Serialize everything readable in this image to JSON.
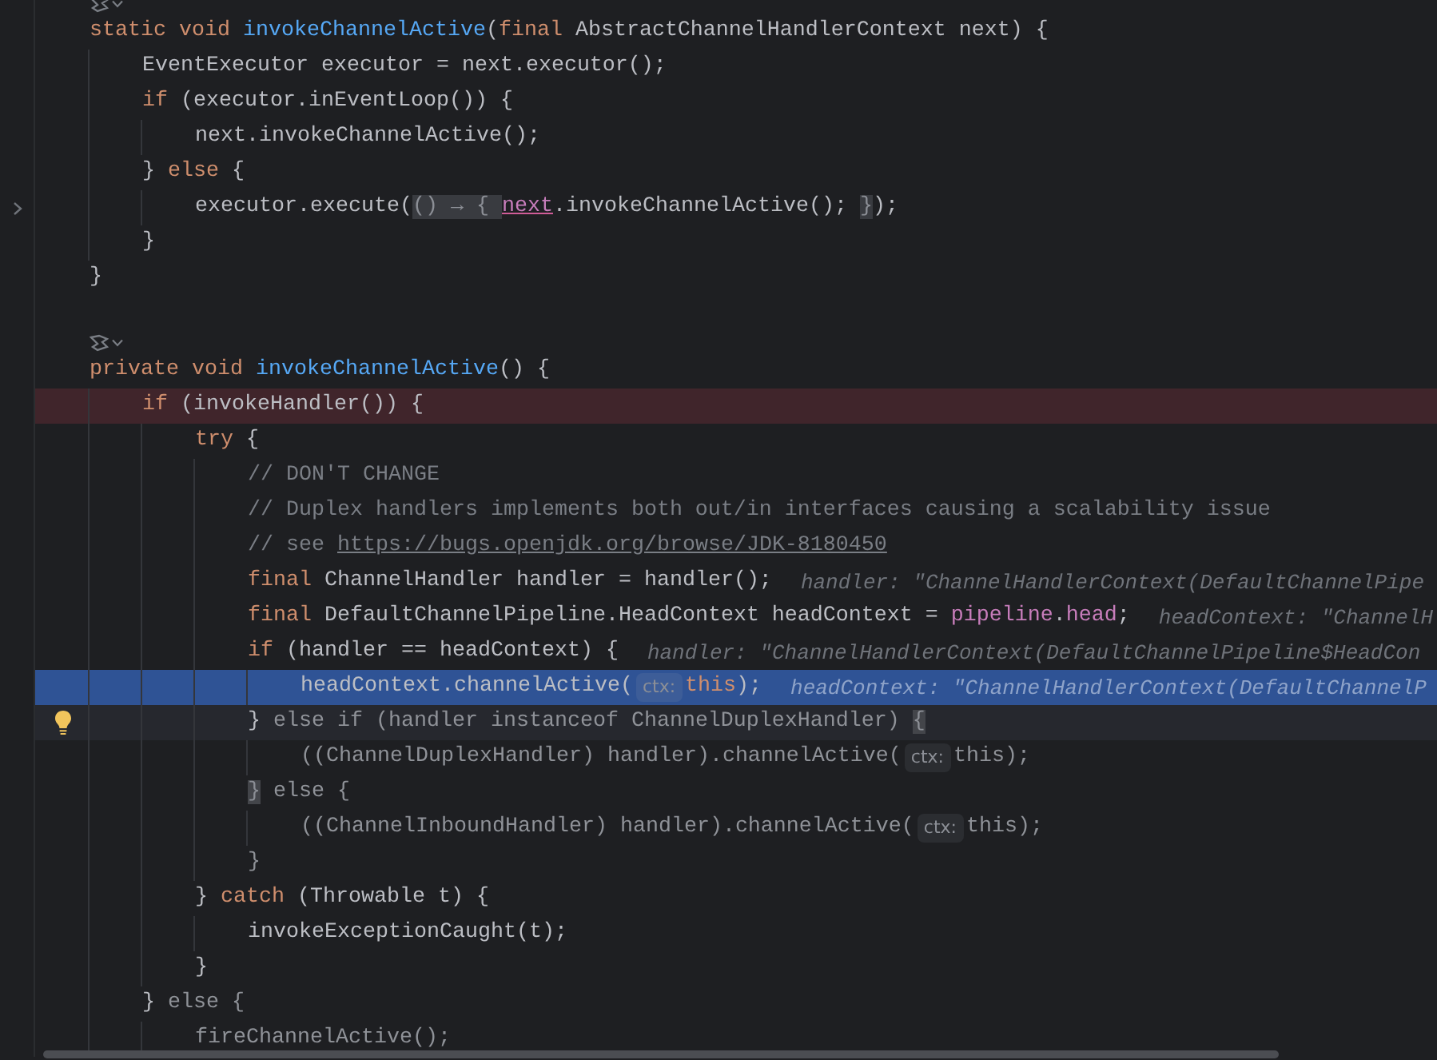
{
  "editor": {
    "lines": [
      {
        "kind": "lens"
      },
      {
        "kind": "code",
        "segments": [
          {
            "kind": "code",
            "tokens": [
              {
                "kind": "keyword",
                "text": "static void "
              },
              {
                "kind": "method",
                "text": "invokeChannelActive"
              },
              {
                "kind": "plain",
                "text": "("
              },
              {
                "kind": "keyword",
                "text": "final"
              },
              {
                "kind": "plain",
                "text": " AbstractChannelHandlerContext next) {"
              }
            ]
          }
        ]
      },
      {
        "kind": "code",
        "segments": [
          {
            "kind": "code",
            "tokens": [
              {
                "kind": "plain",
                "text": "    EventExecutor executor = next.executor();"
              }
            ]
          }
        ]
      },
      {
        "kind": "code",
        "segments": [
          {
            "kind": "code",
            "tokens": [
              {
                "kind": "keyword",
                "text": "    if"
              },
              {
                "kind": "plain",
                "text": " (executor.inEventLoop()) {"
              }
            ]
          }
        ]
      },
      {
        "kind": "code",
        "segments": [
          {
            "kind": "code",
            "tokens": [
              {
                "kind": "plain",
                "text": "        next.invokeChannelActive();"
              }
            ]
          }
        ]
      },
      {
        "kind": "code",
        "segments": [
          {
            "kind": "code",
            "tokens": [
              {
                "kind": "plain",
                "text": "    } "
              },
              {
                "kind": "keyword",
                "text": "else"
              },
              {
                "kind": "plain",
                "text": " {"
              }
            ]
          }
        ]
      },
      {
        "kind": "code",
        "fold_marker": true,
        "segments": [
          {
            "kind": "code",
            "tokens": [
              {
                "kind": "plain",
                "text": "        executor.execute("
              },
              {
                "kind": "folded",
                "text": "() → { "
              },
              {
                "kind": "captured",
                "text": "next"
              },
              {
                "kind": "plain",
                "text": ".invokeChannelActive(); "
              },
              {
                "kind": "folded",
                "text": "}"
              },
              {
                "kind": "plain",
                "text": ");"
              }
            ]
          }
        ]
      },
      {
        "kind": "code",
        "segments": [
          {
            "kind": "code",
            "tokens": [
              {
                "kind": "plain",
                "text": "    }"
              }
            ]
          }
        ]
      },
      {
        "kind": "code",
        "segments": [
          {
            "kind": "code",
            "tokens": [
              {
                "kind": "plain",
                "text": "}"
              }
            ]
          }
        ]
      },
      {
        "kind": "blank"
      },
      {
        "kind": "lens"
      },
      {
        "kind": "code",
        "segments": [
          {
            "kind": "code",
            "tokens": [
              {
                "kind": "keyword",
                "text": "private void "
              },
              {
                "kind": "method",
                "text": "invokeChannelActive"
              },
              {
                "kind": "plain",
                "text": "() {"
              }
            ]
          }
        ]
      },
      {
        "kind": "code",
        "breakpoint": true,
        "segments": [
          {
            "kind": "code",
            "tokens": [
              {
                "kind": "keyword",
                "text": "    if"
              },
              {
                "kind": "plain",
                "text": " (invokeHandler()) {"
              }
            ]
          }
        ]
      },
      {
        "kind": "code",
        "segments": [
          {
            "kind": "code",
            "tokens": [
              {
                "kind": "keyword",
                "text": "        try"
              },
              {
                "kind": "plain",
                "text": " {"
              }
            ]
          }
        ]
      },
      {
        "kind": "code",
        "segments": [
          {
            "kind": "code",
            "tokens": [
              {
                "kind": "comment",
                "text": "            // DON'T CHANGE"
              }
            ]
          }
        ]
      },
      {
        "kind": "code",
        "segments": [
          {
            "kind": "code",
            "tokens": [
              {
                "kind": "comment",
                "text": "            // Duplex handlers implements both out/in interfaces causing a scalability issue"
              }
            ]
          }
        ]
      },
      {
        "kind": "code",
        "segments": [
          {
            "kind": "code",
            "tokens": [
              {
                "kind": "comment",
                "text": "            // see "
              },
              {
                "kind": "link",
                "text": "https://bugs.openjdk.org/browse/JDK-8180450"
              }
            ]
          }
        ]
      },
      {
        "kind": "code",
        "segments": [
          {
            "kind": "code",
            "tokens": [
              {
                "kind": "keyword",
                "text": "            final"
              },
              {
                "kind": "plain",
                "text": " ChannelHandler handler = handler();"
              }
            ]
          },
          {
            "kind": "value",
            "text": "handler: \"ChannelHandlerContext(DefaultChannelPipe"
          }
        ]
      },
      {
        "kind": "code",
        "segments": [
          {
            "kind": "code",
            "tokens": [
              {
                "kind": "keyword",
                "text": "            final"
              },
              {
                "kind": "plain",
                "text": " DefaultChannelPipeline.HeadContext headContext = "
              },
              {
                "kind": "field",
                "text": "pipeline"
              },
              {
                "kind": "plain",
                "text": "."
              },
              {
                "kind": "field",
                "text": "head"
              },
              {
                "kind": "plain",
                "text": ";"
              }
            ]
          },
          {
            "kind": "value",
            "text": "headContext: \"ChannelH"
          }
        ]
      },
      {
        "kind": "code",
        "segments": [
          {
            "kind": "code",
            "tokens": [
              {
                "kind": "keyword",
                "text": "            if"
              },
              {
                "kind": "plain",
                "text": " (handler == headContext) {"
              }
            ]
          },
          {
            "kind": "value",
            "text": "handler: \"ChannelHandlerContext(DefaultChannelPipeline$HeadCon"
          }
        ]
      },
      {
        "kind": "code",
        "execution_point": true,
        "segments": [
          {
            "kind": "code",
            "tokens": [
              {
                "kind": "plain",
                "text": "                headContext.channelActive("
              }
            ]
          },
          {
            "kind": "hint",
            "text": "ctx:"
          },
          {
            "kind": "code",
            "tokens": [
              {
                "kind": "keyword",
                "text": "this"
              },
              {
                "kind": "plain",
                "text": ");"
              }
            ]
          },
          {
            "kind": "value",
            "text": "headContext: \"ChannelHandlerContext(DefaultChannelP"
          }
        ]
      },
      {
        "kind": "code",
        "caret_line": true,
        "intention_bulb": true,
        "segments": [
          {
            "kind": "code",
            "tokens": [
              {
                "kind": "plain",
                "text": "            }"
              },
              {
                "kind": "dim",
                "text": " else if (handler instanceof ChannelDuplexHandler) "
              },
              {
                "kind": "brace",
                "text": "{"
              }
            ]
          }
        ]
      },
      {
        "kind": "code",
        "segments": [
          {
            "kind": "code",
            "tokens": [
              {
                "kind": "dim",
                "text": "                ((ChannelDuplexHandler) handler).channelActive("
              }
            ]
          },
          {
            "kind": "hint",
            "text": "ctx:"
          },
          {
            "kind": "code",
            "tokens": [
              {
                "kind": "dim",
                "text": "this);"
              }
            ]
          }
        ]
      },
      {
        "kind": "code",
        "segments": [
          {
            "kind": "code",
            "tokens": [
              {
                "kind": "brace",
                "text": "            }"
              },
              {
                "kind": "dim",
                "text": " else {"
              }
            ]
          }
        ]
      },
      {
        "kind": "code",
        "segments": [
          {
            "kind": "code",
            "tokens": [
              {
                "kind": "dim",
                "text": "                ((ChannelInboundHandler) handler).channelActive("
              }
            ]
          },
          {
            "kind": "hint",
            "text": "ctx:"
          },
          {
            "kind": "code",
            "tokens": [
              {
                "kind": "dim",
                "text": "this);"
              }
            ]
          }
        ]
      },
      {
        "kind": "code",
        "segments": [
          {
            "kind": "code",
            "tokens": [
              {
                "kind": "dim",
                "text": "            }"
              }
            ]
          }
        ]
      },
      {
        "kind": "code",
        "segments": [
          {
            "kind": "code",
            "tokens": [
              {
                "kind": "plain",
                "text": "        } "
              },
              {
                "kind": "keyword",
                "text": "catch"
              },
              {
                "kind": "plain",
                "text": " (Throwable t) {"
              }
            ]
          }
        ]
      },
      {
        "kind": "code",
        "segments": [
          {
            "kind": "code",
            "tokens": [
              {
                "kind": "plain",
                "text": "            invokeExceptionCaught(t);"
              }
            ]
          }
        ]
      },
      {
        "kind": "code",
        "segments": [
          {
            "kind": "code",
            "tokens": [
              {
                "kind": "plain",
                "text": "        }"
              }
            ]
          }
        ]
      },
      {
        "kind": "code",
        "segments": [
          {
            "kind": "code",
            "tokens": [
              {
                "kind": "plain",
                "text": "    }"
              },
              {
                "kind": "dim",
                "text": " else {"
              }
            ]
          }
        ]
      },
      {
        "kind": "code",
        "segments": [
          {
            "kind": "code",
            "tokens": [
              {
                "kind": "dim",
                "text": "        fireChannelActive();"
              }
            ]
          }
        ]
      }
    ]
  }
}
